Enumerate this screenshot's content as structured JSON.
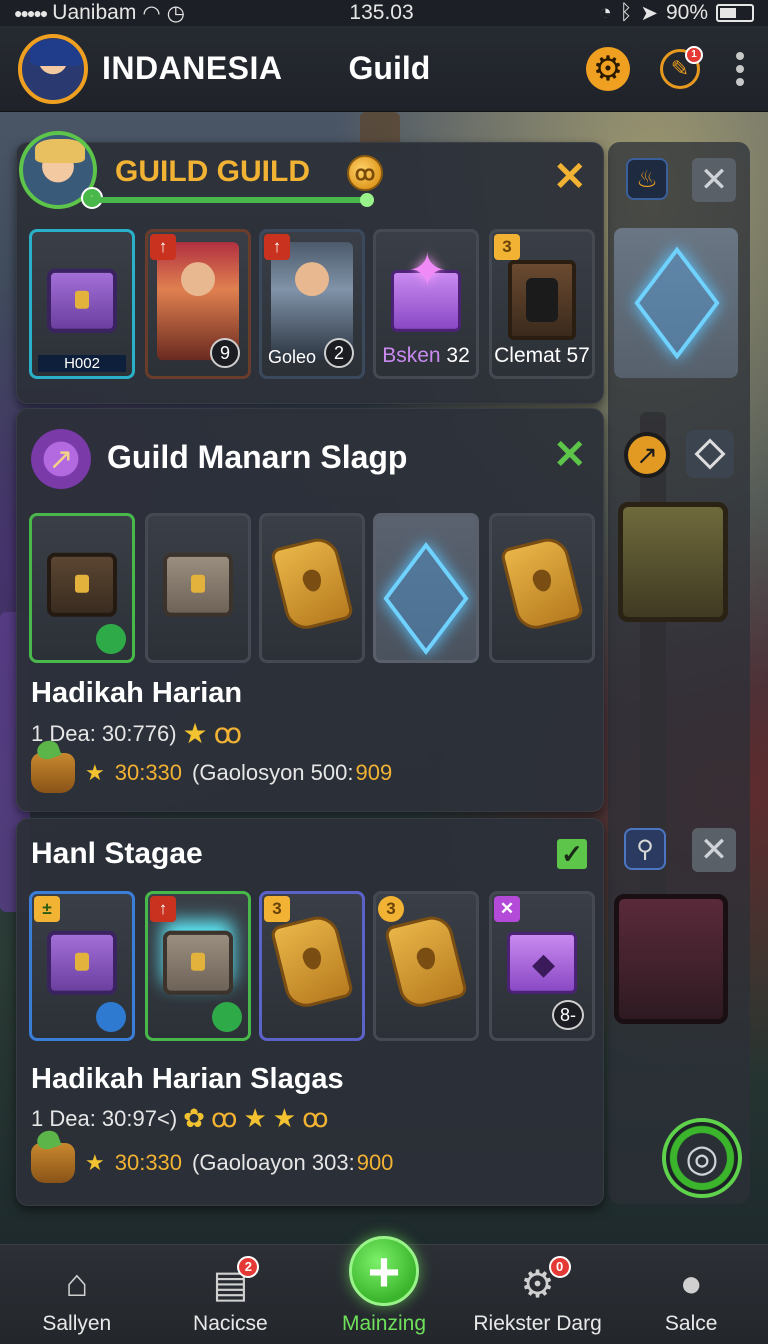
{
  "status_bar": {
    "carrier": "Uanibam",
    "time": "135.03",
    "battery": "90%"
  },
  "header": {
    "title": "INDANESIA",
    "section": "Guild",
    "notification_badge": "1"
  },
  "guild_panel": {
    "title": "GUILD GUILD",
    "items": [
      {
        "label": "H002",
        "count": ""
      },
      {
        "label": "",
        "count": "9"
      },
      {
        "label": "Goleo",
        "count": "2"
      },
      {
        "label": "Bsken",
        "count": "32"
      },
      {
        "label": "Clemat",
        "count": "57"
      }
    ],
    "corner_badges": [
      "↑",
      "↑",
      "3"
    ]
  },
  "mission_panel": {
    "title": "Guild Manarn Slagp",
    "reward_title": "Hadikah Harian",
    "reward_line": "1 Dea: 30:776)",
    "stat_value": "30:330",
    "stat_text": "(Gaolosyon 500:",
    "stat_highlight": "909"
  },
  "stage_panel": {
    "title": "Hanl Stagae",
    "reward_title": "Hadikah Harian Slagas",
    "reward_line": "1 Dea: 30:97<)",
    "stat_value": "30:330",
    "stat_text": "(Gaoloayon 303:",
    "stat_highlight": "900",
    "last_item_count": "8-",
    "corner_badges": [
      "±",
      "↑",
      "3",
      "3",
      "✕"
    ]
  },
  "bottom_nav": [
    {
      "label": "Sallyen",
      "icon": "home-icon"
    },
    {
      "label": "Nacicse",
      "icon": "calendar-icon",
      "badge": "2"
    },
    {
      "label": "Mainzing",
      "icon": "plus-icon",
      "active": true
    },
    {
      "label": "Riekster Darg",
      "icon": "shop-icon",
      "badge": "0"
    },
    {
      "label": "Salce",
      "icon": "profile-icon"
    }
  ],
  "colors": {
    "accent_gold": "#f2b233",
    "accent_green": "#5dc54a",
    "panel_bg": "#2c3038"
  }
}
